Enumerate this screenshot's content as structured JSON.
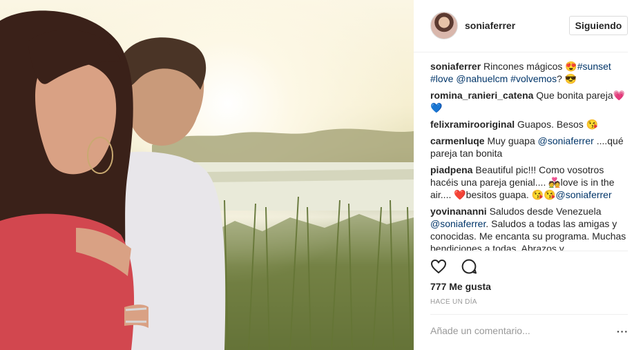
{
  "post": {
    "username": "soniaferrer",
    "follow_label": "Siguiendo",
    "likes": "777 Me gusta",
    "time": "HACE UN DÍA",
    "add_comment_placeholder": "Añade un comentario...",
    "more_label": "···"
  },
  "caption": {
    "user": "soniaferrer",
    "text_1": "Rincones mágicos 😍",
    "tag_1": "#sunset",
    "tag_2": "#love",
    "mention_1": "@nahuelcm",
    "tag_3": "#volvemos",
    "text_2": "? 😎"
  },
  "comments": [
    {
      "user": "romina_ranieri_catena",
      "text": "Que bonita pareja💗💙"
    },
    {
      "user": "felixramirooriginal",
      "text": "Guapos. Besos 😘"
    },
    {
      "user": "carmenluqe",
      "text_1": "Muy guapa",
      "mention": "@soniaferrer",
      "text_2": "....qué pareja tan bonita"
    },
    {
      "user": "piadpena",
      "text_1": "Beautiful pic!!! Como vosotros hacéis una pareja genial.... 💑love is in the air.... ❤️besitos guapa. 😘😘",
      "mention": "@soniaferrer"
    },
    {
      "user": "yovinananni",
      "text_1": "Saludos desde Venezuela",
      "mention": "@soniaferrer",
      "text_2": ". Saludos a todas las amigas y conocidas. Me encanta su programa. Muchas bendiciones a todas. Abrazos y"
    }
  ],
  "icons": {
    "like": "heart-icon",
    "comment": "comment-icon",
    "avatar": "profile-photo"
  }
}
